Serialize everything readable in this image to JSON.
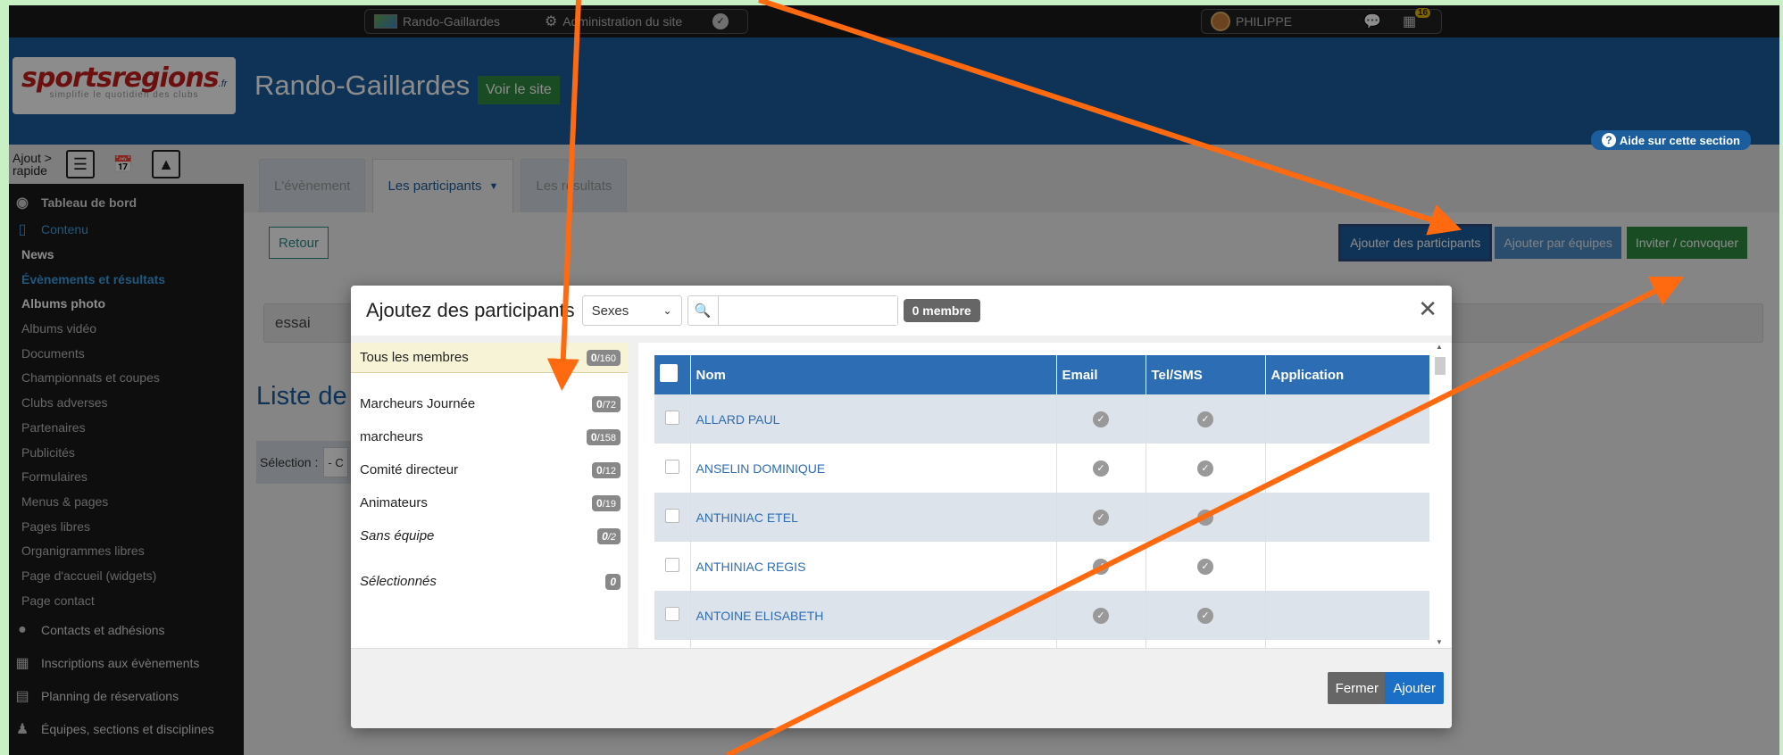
{
  "topbar": {
    "site_name": "Rando-Gaillardes",
    "admin_label": "Administration du site",
    "user_name": "PHILIPPE",
    "notif_count": "16"
  },
  "header": {
    "logo_text_red": "sports",
    "logo_text_blue": "regions",
    "logo_tld": ".fr",
    "logo_tagline": "simplifie le quotidien des clubs",
    "site_title": "Rando-Gaillardes",
    "voir_button": "Voir le site",
    "help_link": "Aide sur cette section"
  },
  "sidebar": {
    "quickadd_label_1": "Ajout",
    "quickadd_label_2": "rapide",
    "dashboard": "Tableau de bord",
    "contenu": "Contenu",
    "sub_items": [
      "News",
      "Évènements et résultats",
      "Albums photo",
      "Albums vidéo",
      "Documents",
      "Championnats et coupes",
      "Clubs adverses",
      "Partenaires",
      "Publicités",
      "Formulaires",
      "Menus & pages",
      "Pages libres",
      "Organigrammes libres",
      "Page d'accueil (widgets)",
      "Page contact"
    ],
    "sections": [
      "Contacts et adhésions",
      "Inscriptions aux évènements",
      "Planning de réservations",
      "Équipes, sections et disciplines"
    ]
  },
  "tabs": [
    "L'évènement",
    "Les participants",
    "Les résultats"
  ],
  "main": {
    "retour": "Retour",
    "btn_add_participants": "Ajouter des participants",
    "btn_add_teams": "Ajouter par équipes",
    "btn_invite": "Inviter / convoquer",
    "event_name": "essai",
    "list_title": "Liste de",
    "selection_label": "Sélection :",
    "selection_value": "- C"
  },
  "modal": {
    "title": "Ajoutez des participants",
    "sex_select": "Sexes",
    "search_placeholder": "",
    "member_count": "0 membre",
    "groups": [
      {
        "name": "Tous les membres",
        "sel": "0",
        "total": "/160"
      },
      {
        "name": "Marcheurs Journée",
        "sel": "0",
        "total": "/72"
      },
      {
        "name": "marcheurs",
        "sel": "0",
        "total": "/158"
      },
      {
        "name": "Comité directeur",
        "sel": "0",
        "total": "/12"
      },
      {
        "name": "Animateurs",
        "sel": "0",
        "total": "/19"
      },
      {
        "name": "Sans équipe",
        "sel": "0",
        "total": "/2"
      },
      {
        "name": "Sélectionnés",
        "sel": "0",
        "total": ""
      }
    ],
    "columns": [
      "Nom",
      "Email",
      "Tel/SMS",
      "Application"
    ],
    "rows": [
      {
        "name": "ALLARD PAUL"
      },
      {
        "name": "ANSELIN DOMINIQUE"
      },
      {
        "name": "ANTHINIAC ETEL"
      },
      {
        "name": "ANTHINIAC REGIS"
      },
      {
        "name": "ANTOINE ELISABETH"
      }
    ],
    "btn_close": "Fermer",
    "btn_add": "Ajouter"
  },
  "colors": {
    "primary_blue": "#1c5e9d",
    "table_header": "#2c6db3",
    "green": "#2e8b3e",
    "arrow_orange": "#ff6a10",
    "page_border": "#c8f0c4"
  }
}
